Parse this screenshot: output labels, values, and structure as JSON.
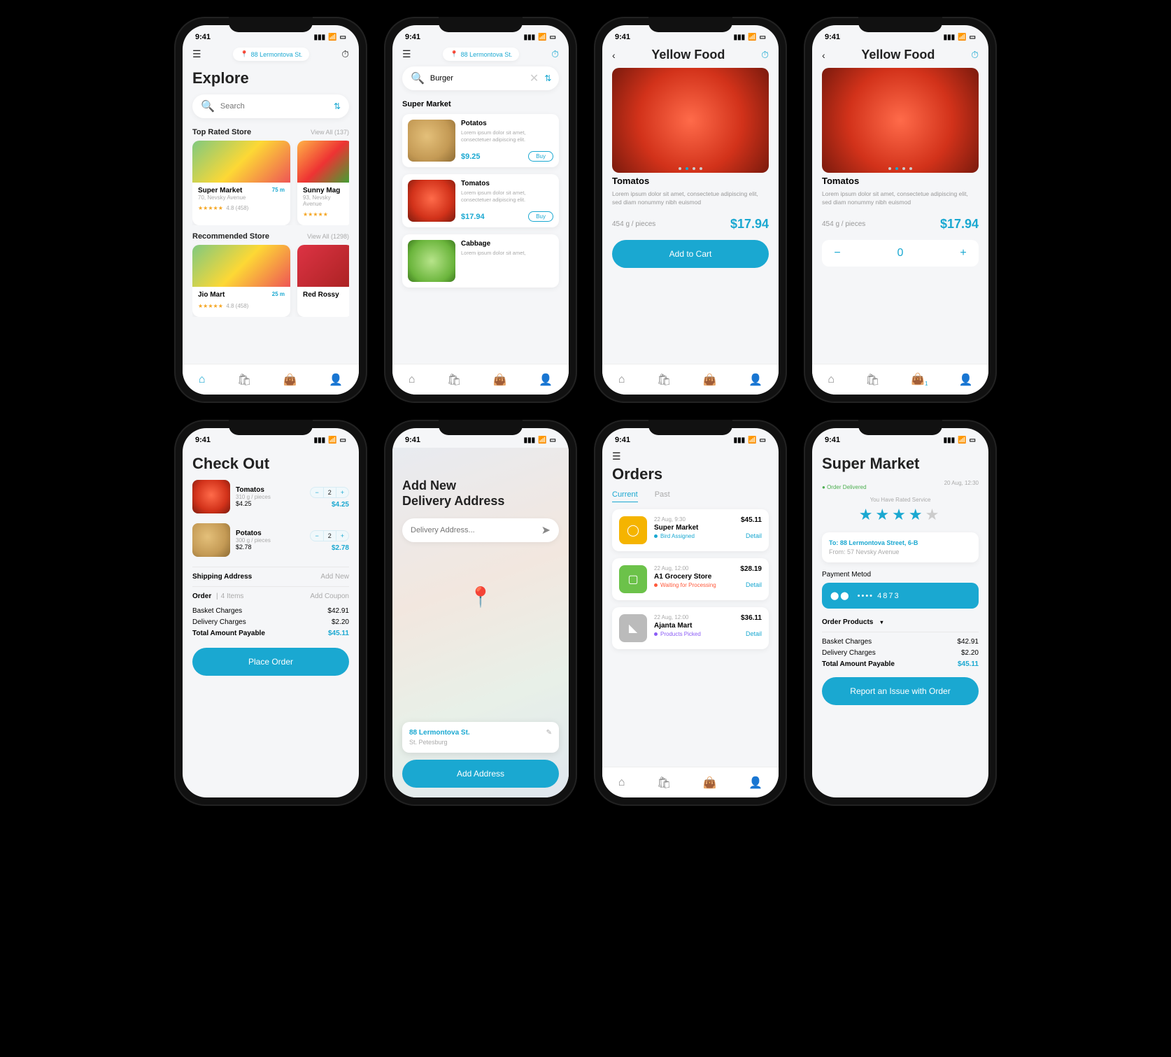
{
  "status_time": "9:41",
  "address_pill": "88 Lermontova St.",
  "explore": {
    "title": "Explore",
    "search_placeholder": "Search",
    "top_rated_label": "Top Rated Store",
    "top_rated_viewall": "View All (137)",
    "stores_top": [
      {
        "name": "Super Market",
        "addr": "70, Nevsky Avenue",
        "rating": "4.8 (458)",
        "distance": "75 m"
      },
      {
        "name": "Sunny Mag",
        "addr": "93, Nevsky Avenue",
        "rating": "",
        "distance": ""
      }
    ],
    "rec_label": "Recommended Store",
    "rec_viewall": "View All (1298)",
    "stores_rec": [
      {
        "name": "Jio Mart",
        "addr": "",
        "rating": "4.8 (458)",
        "distance": "25 m"
      },
      {
        "name": "Red Rossy",
        "addr": "",
        "rating": "",
        "distance": ""
      }
    ]
  },
  "search_results": {
    "query": "Burger",
    "section": "Super Market",
    "products": [
      {
        "name": "Potatos",
        "desc": "Lorem ipsum dolor sit amet, consectetuer adipiscing elit.",
        "price": "$9.25",
        "buy": "Buy"
      },
      {
        "name": "Tomatos",
        "desc": "Lorem ipsum dolor sit amet, consectetuer adipiscing elit.",
        "price": "$17.94",
        "buy": "Buy"
      },
      {
        "name": "Cabbage",
        "desc": "Lorem ipsum dolor sit amet,",
        "price": "",
        "buy": ""
      }
    ]
  },
  "product_detail": {
    "store": "Yellow Food",
    "name": "Tomatos",
    "desc": "Lorem ipsum dolor sit amet, consectetue adipiscing elit, sed diam nonummy nibh euismod",
    "weight": "454 g / pieces",
    "price": "$17.94",
    "add_to_cart": "Add to Cart",
    "qty": "0"
  },
  "checkout": {
    "title": "Check Out",
    "items": [
      {
        "name": "Tomatos",
        "sub": "310 g / pieces",
        "unit": "$4.25",
        "qty": "2",
        "line": "$4.25"
      },
      {
        "name": "Potatos",
        "sub": "300 g / pieces",
        "unit": "$2.78",
        "qty": "2",
        "line": "$2.78"
      }
    ],
    "shipping_label": "Shipping Address",
    "shipping_add": "Add New",
    "order_label": "Order",
    "order_count": "4 Items",
    "order_coupon": "Add Coupon",
    "basket_label": "Basket Charges",
    "basket_val": "$42.91",
    "delivery_label": "Delivery Charges",
    "delivery_val": "$2.20",
    "total_label": "Total Amount Payable",
    "total_val": "$45.11",
    "place_order": "Place Order"
  },
  "address": {
    "title_l1": "Add New",
    "title_l2": "Delivery Address",
    "placeholder": "Delivery Address...",
    "addr1": "88 Lermontova St.",
    "addr2": "St. Petesburg",
    "button": "Add Address"
  },
  "orders": {
    "title": "Orders",
    "tab_current": "Current",
    "tab_past": "Past",
    "list": [
      {
        "time": "22 Aug, 9:30",
        "name": "Super Market",
        "status": "Bird Assigned",
        "dot": "#1aa8d1",
        "price": "$45.11",
        "detail": "Detail",
        "color": "#f5b400"
      },
      {
        "time": "22 Aug, 12:00",
        "name": "A1 Grocery Store",
        "status": "Waiting for Processing",
        "dot": "#ff5a3c",
        "price": "$28.19",
        "detail": "Detail",
        "color": "#6cc24a"
      },
      {
        "time": "22 Aug, 12:00",
        "name": "Ajanta Mart",
        "status": "Products Picked",
        "dot": "#8b5cf6",
        "price": "$36.11",
        "detail": "Detail",
        "color": "#bbb"
      }
    ]
  },
  "receipt": {
    "title": "Super Market",
    "status": "Order Delivered",
    "date": "20 Aug, 12:30",
    "rate_label": "You Have Rated Service",
    "stars": 4,
    "to": "To: 88 Lermontova Street, 6-B",
    "from": "From: 57 Nevsky Avenue",
    "pm_label": "Payment Metod",
    "card_mask": "•••• 4873",
    "op_label": "Order Products",
    "basket_label": "Basket Charges",
    "basket_val": "$42.91",
    "delivery_label": "Delivery Charges",
    "delivery_val": "$2.20",
    "total_label": "Total Amount Payable",
    "total_val": "$45.11",
    "report": "Report an Issue with Order"
  }
}
